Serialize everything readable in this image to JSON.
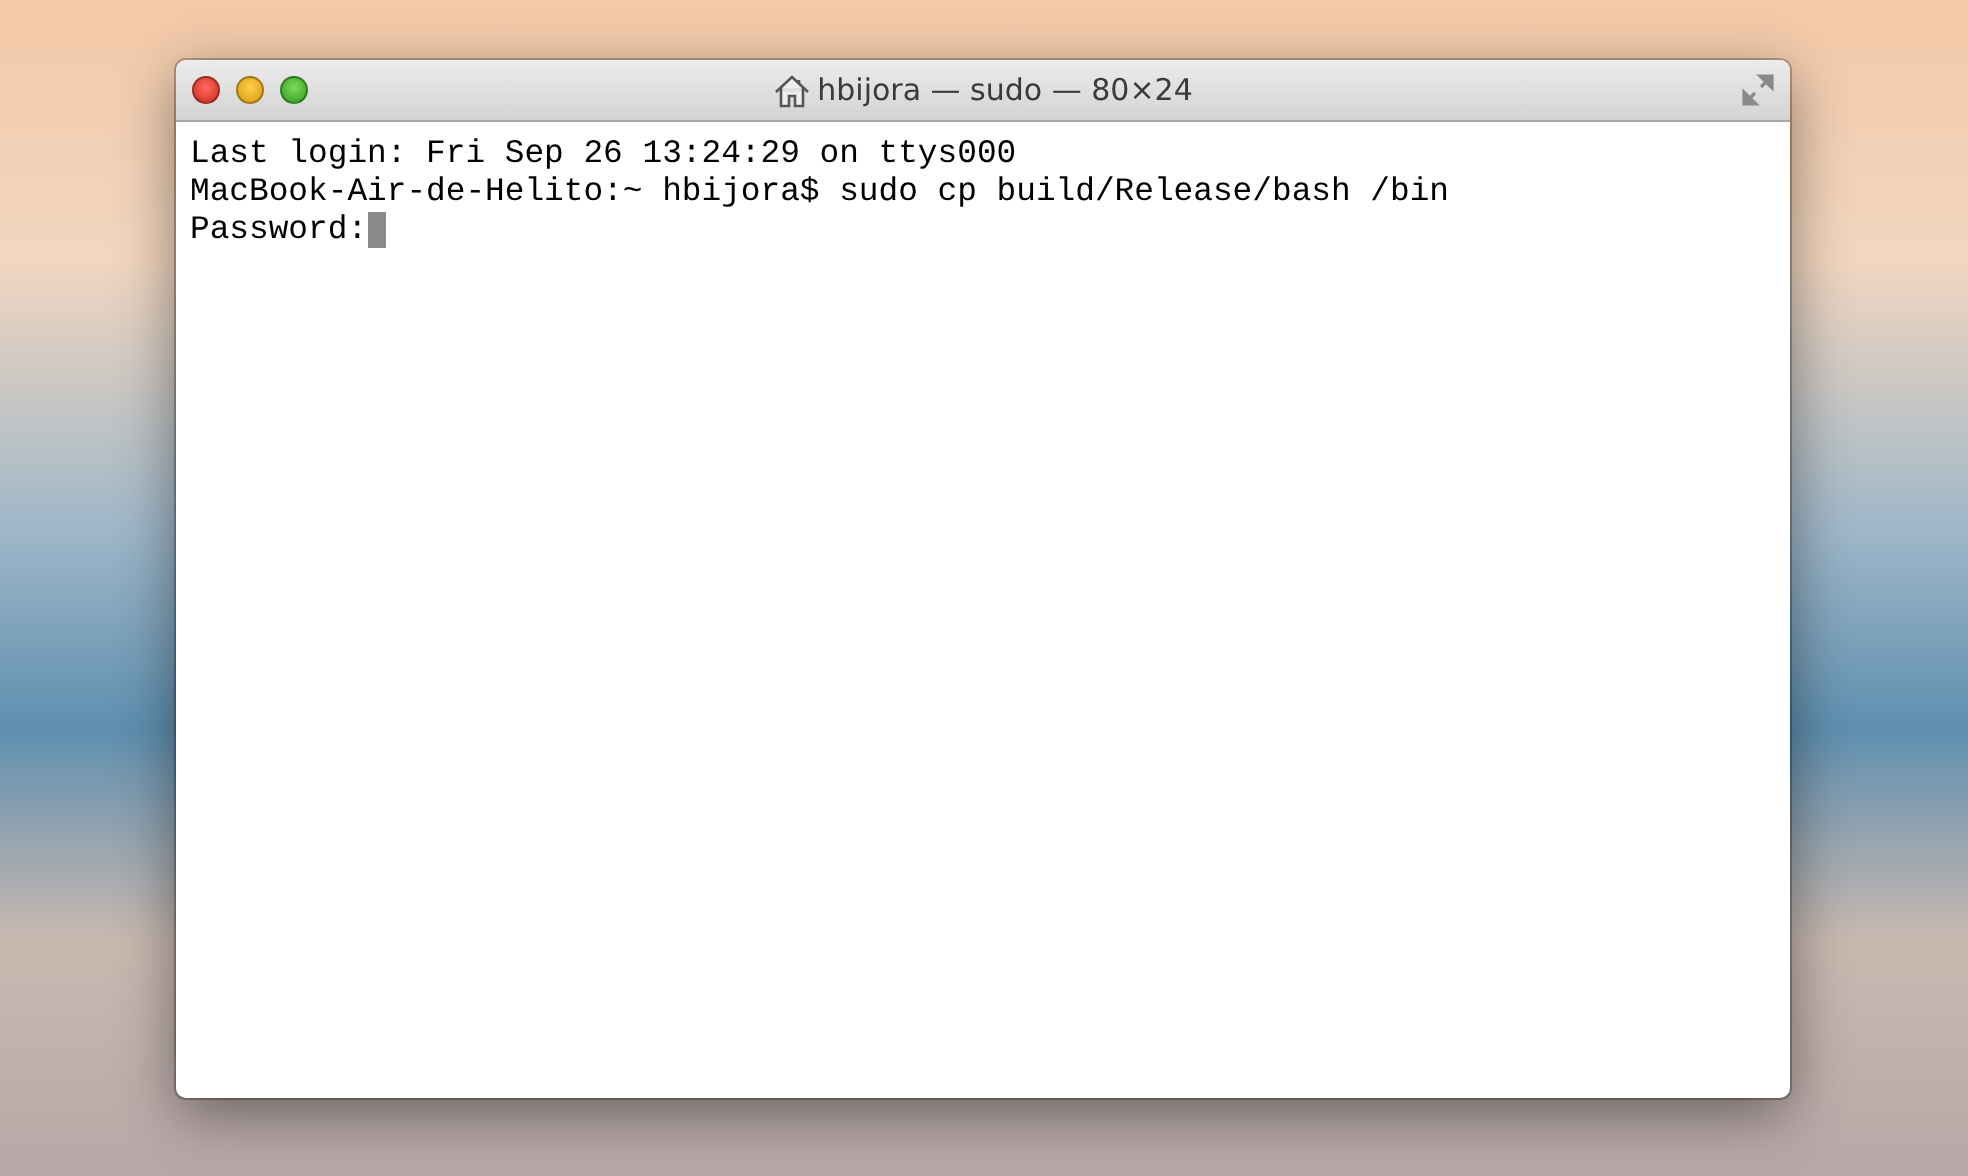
{
  "window": {
    "title": "hbijora — sudo — 80×24"
  },
  "terminal": {
    "lines": [
      {
        "text": "Last login: Fri Sep 26 13:24:29 on ttys000",
        "cursor": false
      },
      {
        "text": "MacBook-Air-de-Helito:~ hbijora$ sudo cp build/Release/bash /bin",
        "cursor": false
      },
      {
        "text": "Password:",
        "cursor": true
      }
    ]
  }
}
